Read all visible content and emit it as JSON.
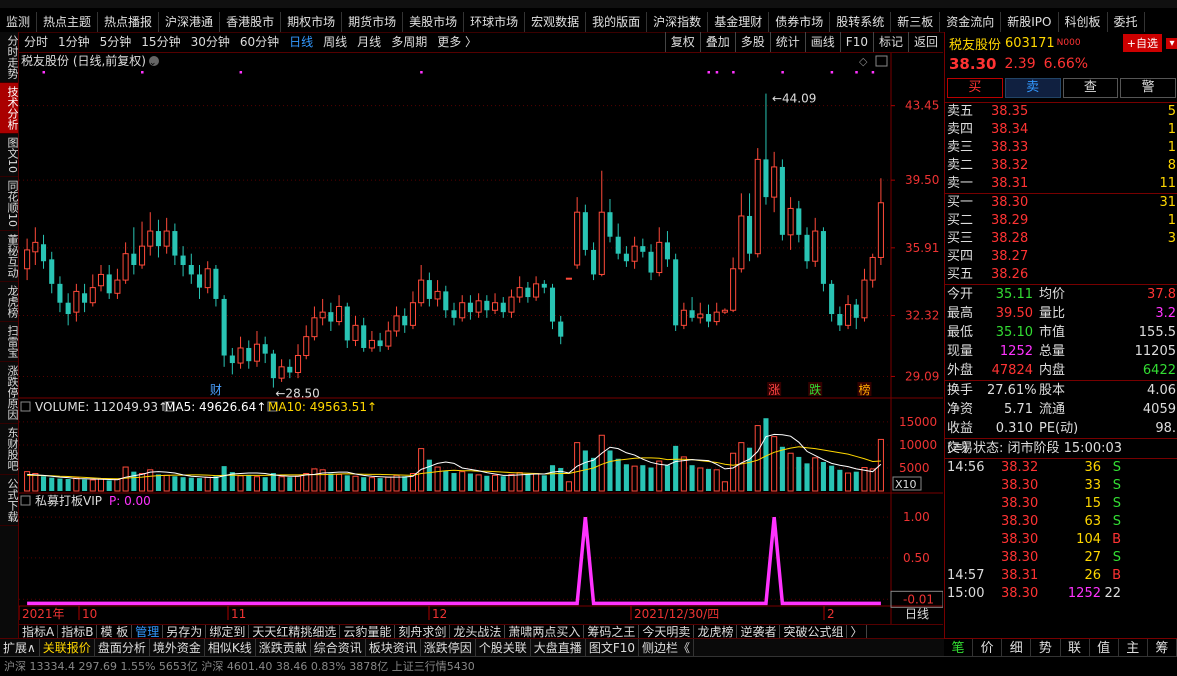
{
  "top_nav": [
    "监测",
    "热点主题",
    "热点播报",
    "沪深港通",
    "香港股市",
    "期权市场",
    "期货市场",
    "美股市场",
    "环球市场",
    "宏观数据",
    "我的版面",
    "沪深指数",
    "基金理财",
    "债券市场",
    "股转系统",
    "新三板",
    "资金流向",
    "新股IPO",
    "科创板",
    "委托"
  ],
  "left_rail": [
    "分时走势",
    "技术分析",
    "图文10",
    "同花顺10",
    "董秘互动",
    "龙虎榜",
    "扫雷宝",
    "涨跌停原因",
    "东财股吧",
    "公式下载"
  ],
  "toolbar": {
    "periods": [
      "分时",
      "1分钟",
      "5分钟",
      "15分钟",
      "30分钟",
      "60分钟",
      "日线",
      "周线",
      "月线",
      "多周期",
      "更多 〉"
    ],
    "selected": "日线",
    "right": [
      "复权",
      "叠加",
      "多股",
      "统计",
      "画线",
      "F10",
      "标记",
      "返回"
    ]
  },
  "chart_data": [
    {
      "type": "candlestick",
      "title": "税友股份 (日线,前复权)",
      "x_labels": [
        "2021年",
        "10",
        "11",
        "12",
        "2021/12/30/四",
        "2"
      ],
      "yticks": [
        "43.45",
        "39.50",
        "35.91",
        "32.32",
        "29.09"
      ],
      "ylim": [
        28.0,
        45.5
      ],
      "high_annotation": "44.09",
      "low_annotation": "28.50",
      "event_markers": [
        {
          "label": "财",
          "color": "#4aa0ff",
          "index": 23
        },
        {
          "label": "涨",
          "color": "#ff4444",
          "index": 91
        },
        {
          "label": "跌",
          "color": "#33dd33",
          "index": 96
        },
        {
          "label": "榜",
          "color": "#ffaa00",
          "index": 102
        }
      ],
      "candles": [
        [
          34.8,
          35.8,
          36.4,
          34.2
        ],
        [
          35.7,
          36.2,
          37.0,
          35.0
        ],
        [
          36.1,
          35.2,
          36.6,
          34.8
        ],
        [
          35.3,
          34.0,
          35.7,
          33.5
        ],
        [
          34.0,
          33.0,
          34.4,
          32.5
        ],
        [
          33.0,
          32.4,
          33.5,
          31.8
        ],
        [
          32.5,
          33.6,
          34.0,
          32.0
        ],
        [
          33.5,
          33.0,
          34.0,
          32.5
        ],
        [
          33.0,
          33.8,
          34.5,
          32.8
        ],
        [
          33.9,
          34.5,
          35.0,
          33.6
        ],
        [
          34.5,
          33.5,
          35.0,
          33.2
        ],
        [
          33.5,
          34.2,
          34.8,
          33.2
        ],
        [
          34.2,
          35.6,
          36.2,
          34.0
        ],
        [
          35.6,
          35.0,
          37.0,
          34.5
        ],
        [
          35.0,
          36.0,
          37.3,
          34.8
        ],
        [
          36.0,
          36.8,
          37.8,
          35.5
        ],
        [
          36.8,
          36.0,
          37.4,
          35.4
        ],
        [
          36.0,
          36.8,
          37.5,
          35.6
        ],
        [
          36.8,
          35.5,
          37.2,
          35.0
        ],
        [
          35.5,
          35.0,
          36.0,
          34.4
        ],
        [
          35.0,
          34.5,
          35.6,
          34.0
        ],
        [
          34.5,
          33.8,
          35.0,
          33.2
        ],
        [
          33.8,
          34.8,
          35.2,
          33.5
        ],
        [
          34.8,
          33.2,
          35.0,
          32.8
        ],
        [
          33.2,
          30.2,
          33.4,
          29.6
        ],
        [
          30.2,
          29.8,
          30.6,
          29.2
        ],
        [
          29.8,
          30.6,
          31.2,
          29.5
        ],
        [
          30.6,
          29.9,
          31.0,
          29.5
        ],
        [
          29.9,
          30.8,
          31.5,
          29.6
        ],
        [
          30.8,
          30.3,
          31.2,
          29.8
        ],
        [
          30.3,
          29.0,
          30.5,
          28.5
        ],
        [
          29.0,
          29.6,
          30.0,
          28.8
        ],
        [
          29.6,
          29.3,
          30.0,
          29.0
        ],
        [
          29.3,
          30.2,
          30.8,
          29.0
        ],
        [
          30.2,
          31.2,
          31.8,
          30.0
        ],
        [
          31.2,
          32.2,
          32.8,
          31.0
        ],
        [
          32.2,
          32.5,
          33.2,
          31.8
        ],
        [
          32.5,
          32.0,
          33.0,
          31.5
        ],
        [
          32.0,
          32.8,
          33.4,
          31.8
        ],
        [
          32.8,
          31.0,
          33.0,
          30.6
        ],
        [
          31.0,
          31.8,
          32.3,
          30.7
        ],
        [
          31.8,
          30.6,
          32.2,
          30.4
        ],
        [
          30.6,
          31.0,
          31.5,
          30.4
        ],
        [
          31.0,
          30.7,
          31.4,
          30.4
        ],
        [
          30.7,
          31.5,
          32.0,
          30.5
        ],
        [
          31.5,
          32.3,
          32.8,
          31.2
        ],
        [
          32.3,
          31.8,
          32.7,
          31.4
        ],
        [
          31.8,
          33.0,
          33.6,
          31.6
        ],
        [
          33.0,
          34.2,
          35.0,
          32.8
        ],
        [
          34.2,
          33.2,
          34.6,
          32.8
        ],
        [
          33.2,
          33.6,
          34.2,
          32.8
        ],
        [
          33.6,
          32.6,
          33.9,
          32.2
        ],
        [
          32.6,
          32.2,
          33.0,
          31.8
        ],
        [
          32.2,
          33.0,
          33.4,
          32.0
        ],
        [
          33.0,
          32.5,
          33.4,
          32.1
        ],
        [
          32.5,
          33.1,
          33.5,
          32.2
        ],
        [
          33.1,
          32.6,
          33.4,
          32.2
        ],
        [
          32.6,
          33.0,
          33.5,
          32.4
        ],
        [
          33.0,
          32.5,
          33.3,
          32.2
        ],
        [
          32.5,
          33.3,
          33.7,
          32.2
        ],
        [
          33.3,
          33.8,
          34.4,
          33.0
        ],
        [
          33.8,
          33.3,
          34.1,
          33.0
        ],
        [
          33.3,
          34.0,
          34.4,
          33.1
        ],
        [
          34.0,
          33.8,
          34.2,
          33.5
        ],
        [
          33.8,
          32.0,
          34.0,
          31.6
        ],
        [
          32.0,
          31.2,
          32.3,
          30.8
        ],
        [
          34.3,
          34.3,
          34.3,
          34.3
        ],
        [
          35.0,
          37.8,
          38.6,
          34.8
        ],
        [
          37.8,
          35.8,
          38.2,
          35.5
        ],
        [
          35.8,
          34.5,
          36.2,
          34.2
        ],
        [
          34.5,
          37.8,
          40.0,
          34.4
        ],
        [
          37.8,
          36.5,
          38.5,
          36.2
        ],
        [
          36.5,
          35.6,
          37.2,
          35.3
        ],
        [
          35.6,
          35.2,
          36.0,
          34.9
        ],
        [
          35.2,
          36.0,
          36.5,
          34.8
        ],
        [
          36.0,
          35.7,
          36.4,
          35.4
        ],
        [
          35.7,
          34.6,
          36.1,
          34.2
        ],
        [
          34.6,
          36.2,
          37.0,
          34.4
        ],
        [
          36.2,
          35.3,
          36.8,
          34.9
        ],
        [
          35.3,
          31.8,
          35.6,
          31.5
        ],
        [
          31.8,
          32.6,
          33.0,
          31.6
        ],
        [
          32.6,
          32.2,
          33.3,
          32.0
        ],
        [
          32.2,
          32.4,
          33.0,
          31.9
        ],
        [
          32.4,
          32.0,
          32.9,
          31.7
        ],
        [
          32.0,
          32.5,
          33.0,
          31.8
        ],
        [
          32.5,
          32.6,
          32.7,
          32.4
        ],
        [
          32.6,
          34.8,
          35.4,
          32.5
        ],
        [
          34.8,
          37.6,
          38.8,
          34.6
        ],
        [
          37.6,
          35.6,
          38.8,
          35.2
        ],
        [
          35.6,
          40.6,
          41.2,
          35.4
        ],
        [
          40.6,
          38.6,
          44.09,
          38.2
        ],
        [
          38.6,
          40.2,
          41.0,
          37.8
        ],
        [
          40.2,
          36.6,
          40.6,
          36.3
        ],
        [
          36.6,
          38.0,
          38.6,
          35.8
        ],
        [
          38.0,
          36.6,
          38.4,
          36.2
        ],
        [
          36.6,
          35.2,
          37.0,
          34.8
        ],
        [
          35.2,
          36.8,
          37.5,
          34.9
        ],
        [
          36.8,
          34.0,
          37.0,
          33.6
        ],
        [
          34.0,
          32.4,
          34.2,
          32.0
        ],
        [
          32.4,
          31.8,
          32.8,
          31.5
        ],
        [
          31.8,
          32.9,
          33.4,
          31.6
        ],
        [
          32.9,
          32.2,
          33.2,
          31.6
        ],
        [
          32.2,
          34.2,
          34.8,
          32.0
        ],
        [
          34.2,
          35.4,
          35.6,
          33.8
        ],
        [
          35.4,
          38.3,
          39.6,
          35.0
        ]
      ]
    },
    {
      "type": "bar",
      "title": "VOLUME: 112049.93",
      "legend": [
        {
          "label": "VOLUME: 112049.93↑",
          "color": "#dddddd"
        },
        {
          "label": "MA5: 49626.64↑",
          "color": "#ffffff"
        },
        {
          "label": "MA10: 49563.51↑",
          "color": "#ffd700"
        }
      ],
      "yticks": [
        "15000",
        "10000",
        "5000"
      ],
      "unit_label": "X10",
      "ylim": [
        0,
        16500
      ],
      "values": [
        4200,
        3800,
        3200,
        2900,
        2700,
        2600,
        2800,
        2500,
        2400,
        2600,
        2300,
        2500,
        5200,
        4200,
        3800,
        4600,
        3600,
        3400,
        3200,
        3000,
        2900,
        2800,
        3000,
        3200,
        5400,
        4100,
        3300,
        3500,
        3100,
        3000,
        3900,
        3100,
        3000,
        3200,
        3800,
        4800,
        4600,
        3800,
        3600,
        3400,
        3200,
        3000,
        2900,
        2800,
        3000,
        3400,
        3200,
        3800,
        9200,
        6800,
        5200,
        4400,
        3900,
        4200,
        3800,
        3500,
        3300,
        3400,
        3200,
        3600,
        4000,
        3600,
        3800,
        3400,
        5600,
        5000,
        2000,
        10500,
        8800,
        7200,
        12100,
        8800,
        7000,
        5800,
        5400,
        5600,
        5100,
        6500,
        5600,
        9800,
        7400,
        5600,
        5000,
        4800,
        4600,
        2000,
        8200,
        10500,
        9400,
        14200,
        15800,
        11800,
        9600,
        8200,
        7400,
        6000,
        7200,
        6300,
        5500,
        4600,
        3900,
        4200,
        5100,
        4800,
        11200
      ],
      "ma5": [
        3600,
        3500,
        3400,
        3200,
        3000,
        2900,
        2700,
        2650,
        2600,
        2550,
        2500,
        2450,
        3000,
        3300,
        3600,
        4100,
        4200,
        4100,
        3900,
        3500,
        3200,
        3100,
        2950,
        2900,
        3300,
        3700,
        3800,
        3900,
        3900,
        3800,
        3500,
        3300,
        3200,
        3200,
        3500,
        3600,
        3900,
        4000,
        4100,
        4100,
        3700,
        3400,
        3200,
        3100,
        3000,
        3000,
        3050,
        3200,
        4700,
        5300,
        6000,
        6300,
        6000,
        5000,
        4700,
        4400,
        4000,
        3700,
        3400,
        3400,
        3500,
        3600,
        3700,
        3700,
        4100,
        4300,
        3900,
        5400,
        6200,
        6700,
        8200,
        9500,
        9200,
        8300,
        7800,
        6900,
        6200,
        5800,
        5600,
        6400,
        6600,
        6800,
        6700,
        6600,
        5800,
        4800,
        5000,
        6100,
        6900,
        8600,
        11800,
        12300,
        12200,
        11900,
        10600,
        8600,
        7700,
        6800,
        6000,
        5600,
        5300,
        4800,
        4500,
        4200,
        5800
      ],
      "ma10": [
        3400,
        3400,
        3350,
        3300,
        3200,
        3150,
        3050,
        2950,
        2850,
        2750,
        2700,
        2650,
        2800,
        2900,
        3000,
        3200,
        3350,
        3400,
        3450,
        3450,
        3500,
        3500,
        3450,
        3350,
        3400,
        3450,
        3400,
        3400,
        3400,
        3400,
        3450,
        3500,
        3500,
        3500,
        3550,
        3550,
        3550,
        3600,
        3700,
        3750,
        3700,
        3650,
        3600,
        3600,
        3550,
        3500,
        3450,
        3400,
        3800,
        4000,
        4200,
        4400,
        4500,
        4400,
        4400,
        4300,
        4300,
        4200,
        4100,
        4000,
        3900,
        3850,
        3800,
        3700,
        3750,
        3800,
        3800,
        4200,
        4600,
        5000,
        5800,
        6400,
        6700,
        6900,
        7100,
        7200,
        7200,
        7100,
        6800,
        6900,
        6900,
        6800,
        6600,
        6400,
        6200,
        5800,
        5600,
        5900,
        6200,
        6700,
        7600,
        8400,
        8900,
        9300,
        9600,
        9400,
        9200,
        8900,
        8600,
        8300,
        8000,
        7500,
        7000,
        6400,
        6500
      ]
    },
    {
      "type": "line",
      "title": "私募打板VIP",
      "legend": [
        {
          "label": "私募打板VIP",
          "color": "#dddddd"
        },
        {
          "label": "P: 0.00",
          "color": "#ff33ff"
        }
      ],
      "yticks": [
        "1.00",
        "0.50",
        "-0.01"
      ],
      "ylim": [
        -0.08,
        1.1
      ],
      "pulses": [
        68,
        91
      ]
    }
  ],
  "right_panel": {
    "name": "税友股份",
    "code": "603171",
    "tag": "N000",
    "add_label": "+自选",
    "dropdown_icon": "chevron-down-icon",
    "price": "38.30",
    "change": "2.39",
    "change_pct": "6.66%",
    "buttons": [
      "买",
      "卖",
      "查",
      "警"
    ],
    "asks": [
      {
        "label": "卖五",
        "price": "38.35",
        "qty": "5"
      },
      {
        "label": "卖四",
        "price": "38.34",
        "qty": "1"
      },
      {
        "label": "卖三",
        "price": "38.33",
        "qty": "1"
      },
      {
        "label": "卖二",
        "price": "38.32",
        "qty": "8"
      },
      {
        "label": "卖一",
        "price": "38.31",
        "qty": "11"
      }
    ],
    "bids": [
      {
        "label": "买一",
        "price": "38.30",
        "qty": "31"
      },
      {
        "label": "买二",
        "price": "38.29",
        "qty": "1"
      },
      {
        "label": "买三",
        "price": "38.28",
        "qty": "3"
      },
      {
        "label": "买四",
        "price": "38.27",
        "qty": ""
      },
      {
        "label": "买五",
        "price": "38.26",
        "qty": ""
      }
    ],
    "quote1": [
      {
        "l": "今开",
        "v": "35.11",
        "vc": "grn",
        "l2": "均价",
        "v2": "37.8",
        "v2c": "red"
      },
      {
        "l": "最高",
        "v": "39.50",
        "vc": "red",
        "l2": "量比",
        "v2": "3.2",
        "v2c": "mag"
      },
      {
        "l": "最低",
        "v": "35.10",
        "vc": "grn",
        "l2": "市值",
        "v2": "155.5",
        "v2c": "wht"
      },
      {
        "l": "现量",
        "v": "1252",
        "vc": "mag",
        "l2": "总量",
        "v2": "11205",
        "v2c": "wht"
      },
      {
        "l": "外盘",
        "v": "47824",
        "vc": "red",
        "l2": "内盘",
        "v2": "6422",
        "v2c": "grn"
      }
    ],
    "quote2": [
      {
        "l": "换手",
        "v": "27.61%",
        "l2": "股本",
        "v2": "4.06"
      },
      {
        "l": "净资",
        "v": "5.71",
        "l2": "流通",
        "v2": "4059"
      },
      {
        "l": "收益(≡)",
        "v": "0.310",
        "l2": "PE(动)",
        "v2": "98."
      }
    ],
    "status": "交易状态: 闭市阶段 15:00:03",
    "trades": [
      {
        "t": "14:56",
        "p": "38.32",
        "q": "36",
        "s": "S",
        "sc": "grn"
      },
      {
        "t": "",
        "p": "38.30",
        "q": "33",
        "s": "S",
        "sc": "grn"
      },
      {
        "t": "",
        "p": "38.30",
        "q": "15",
        "s": "S",
        "sc": "grn"
      },
      {
        "t": "",
        "p": "38.30",
        "q": "63",
        "s": "S",
        "sc": "grn"
      },
      {
        "t": "",
        "p": "38.30",
        "q": "104",
        "s": "B",
        "sc": "red"
      },
      {
        "t": "",
        "p": "38.30",
        "q": "27",
        "s": "S",
        "sc": "grn"
      },
      {
        "t": "14:57",
        "p": "38.31",
        "q": "26",
        "s": "B",
        "sc": "red"
      },
      {
        "t": "15:00",
        "p": "38.30",
        "q": "1252",
        "s": "22",
        "sc": "wht"
      }
    ],
    "bottom_tabs": [
      "笔",
      "价",
      "细",
      "势",
      "联",
      "值",
      "主",
      "筹"
    ]
  },
  "period_label": "日线",
  "indicator_tabs": [
    "指标A",
    "指标B",
    "模 板",
    "管理",
    "另存为",
    "绑定到",
    "天天红精挑细选",
    "云豹量能",
    "刻舟求剑",
    "龙头战法",
    "萧啸两点买入",
    "筹码之王",
    "今天明卖",
    "龙虎榜",
    "逆袭者",
    "突破公式组",
    "〉"
  ],
  "indicator_tab_selected": "管理",
  "plus_minus": [
    "+",
    "−"
  ],
  "bottom_bar": [
    "扩展∧",
    "关联报价",
    "盘面分析",
    "境外资金",
    "相似K线",
    "涨跌贡献",
    "综合资讯",
    "板块资讯",
    "涨跌停因",
    "个股关联",
    "大盘直播",
    "图文F10",
    "侧边栏《"
  ],
  "ticker": "沪深 13334.4  297.69  1.55%  5653亿   沪深 4601.40  38.46  0.83%  3878亿   上证三行情5430"
}
